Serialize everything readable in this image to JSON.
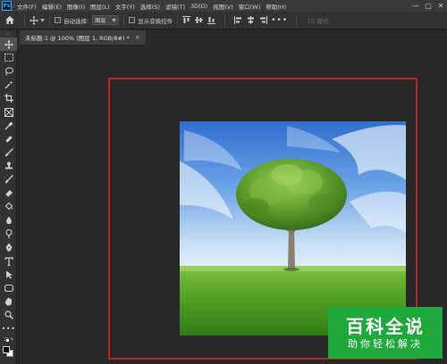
{
  "app": {
    "logo_text": "Ps"
  },
  "menu": {
    "items": [
      "文件(F)",
      "编辑(E)",
      "图像(I)",
      "图层(L)",
      "文字(Y)",
      "选择(S)",
      "滤镜(T)",
      "3D(D)",
      "视图(V)",
      "窗口(W)",
      "帮助(H)"
    ]
  },
  "window_controls": {
    "minimize": "—",
    "maximize": "▢",
    "close": "✕"
  },
  "options": {
    "auto_select_label": "自动选择:",
    "auto_select_value": "图层",
    "transform_controls_label": "显示变换控件",
    "mode3d_label": "3D 模式:"
  },
  "document_tab": {
    "title": "未标题-1 @ 100% (图层 1, RGB/8#) *",
    "close": "×"
  },
  "watermark": {
    "main": "百科全说",
    "sub": "助你轻松解决"
  },
  "colors": {
    "menubar": "#3a3a3a",
    "panel": "#323232",
    "canvas_bg": "#282828",
    "frame": "#c31f1f",
    "watermark": "#1fa83c"
  }
}
